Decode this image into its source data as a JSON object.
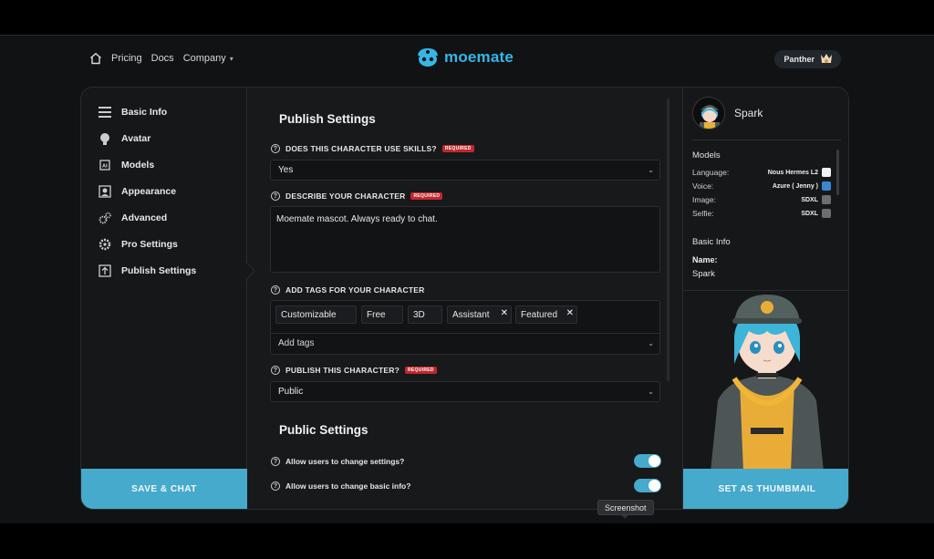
{
  "nav": {
    "links": [
      "Pricing",
      "Docs",
      "Company"
    ],
    "logo": "moemate",
    "user": "Panther"
  },
  "sidebar": {
    "items": [
      {
        "label": "Basic Info",
        "icon": "list-icon"
      },
      {
        "label": "Avatar",
        "icon": "head-icon"
      },
      {
        "label": "Models",
        "icon": "ai-chip-icon"
      },
      {
        "label": "Appearance",
        "icon": "portrait-icon"
      },
      {
        "label": "Advanced",
        "icon": "gears-icon"
      },
      {
        "label": "Pro Settings",
        "icon": "gear-icon"
      },
      {
        "label": "Publish Settings",
        "icon": "upload-icon"
      }
    ],
    "save_button": "SAVE & CHAT"
  },
  "form": {
    "publish_title": "Publish Settings",
    "skills_label": "DOES THIS CHARACTER USE SKILLS?",
    "required": "REQUIRED",
    "skills_value": "Yes",
    "describe_label": "DESCRIBE YOUR CHARACTER",
    "describe_value": "Moemate mascot. Always ready to chat.",
    "tags_label": "ADD TAGS FOR YOUR CHARACTER",
    "tags": [
      "Customizable",
      "Free",
      "3D",
      "Assistant",
      "Featured"
    ],
    "add_tags_placeholder": "Add tags",
    "publish_label": "PUBLISH THIS CHARACTER?",
    "publish_value": "Public",
    "public_title": "Public Settings",
    "toggle1_label": "Allow users to change settings?",
    "toggle2_label": "Allow users to change basic info?"
  },
  "right_panel": {
    "character_name": "Spark",
    "models_heading": "Models",
    "rows": [
      {
        "label": "Language:",
        "value": "Nous Hermes L2"
      },
      {
        "label": "Voice:",
        "value": "Azure ( Jenny )"
      },
      {
        "label": "Image:",
        "value": "SDXL"
      },
      {
        "label": "Selfie:",
        "value": "SDXL"
      }
    ],
    "basic_info_heading": "Basic Info",
    "name_label": "Name:",
    "name_value": "Spark",
    "thumbnail_button": "SET AS THUMBMAIL"
  },
  "tooltip": "Screenshot",
  "colors": {
    "accent": "#46aacc",
    "logo": "#35b7e6",
    "required": "#c1272d"
  }
}
